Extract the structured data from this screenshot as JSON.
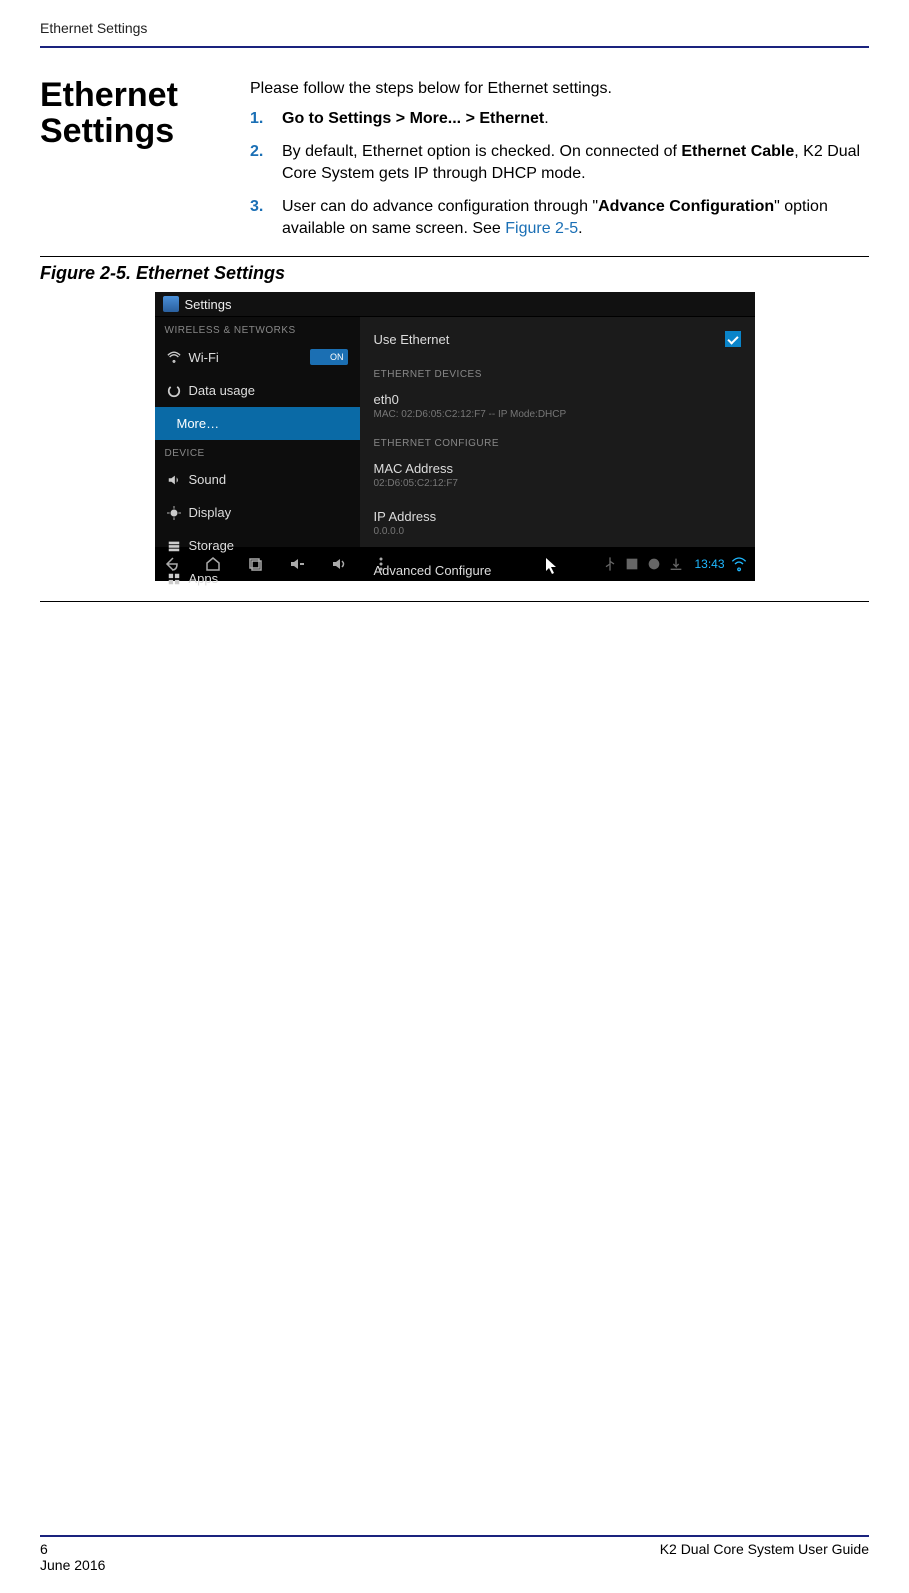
{
  "running_head": "Ethernet Settings",
  "section_heading": "Ethernet Settings",
  "intro": "Please follow the steps below for Ethernet settings.",
  "steps": {
    "s1": {
      "num": "1.",
      "pre": "Go to Settings > More... > Ethernet",
      "post": "."
    },
    "s2": {
      "num": "2.",
      "a": "By default, Ethernet option is checked. On connected of ",
      "b": "Ethernet Cable",
      "c": ", K2 Dual Core System gets IP through DHCP mode."
    },
    "s3": {
      "num": "3.",
      "a": "User can do advance configuration through \"",
      "b": "Advance Configuration",
      "c": "\" option available on same screen. See ",
      "xref": "Figure 2-5",
      "d": "."
    }
  },
  "figure_caption": "Figure 2-5. Ethernet Settings",
  "shot": {
    "title": "Settings",
    "cat1": "WIRELESS & NETWORKS",
    "wifi": "Wi-Fi",
    "wifi_toggle": "ON",
    "data_usage": "Data usage",
    "more": "More…",
    "cat2": "DEVICE",
    "sound": "Sound",
    "display": "Display",
    "storage": "Storage",
    "apps": "Apps",
    "use_eth": "Use Ethernet",
    "eth_devices": "ETHERNET DEVICES",
    "eth0": "eth0",
    "eth0_sub": "MAC: 02:D6:05:C2:12:F7 -- IP Mode:DHCP",
    "eth_conf": "ETHERNET CONFIGURE",
    "mac_addr": "MAC Address",
    "mac_val": "02:D6:05:C2:12:F7",
    "ip_addr": "IP Address",
    "ip_val": "0.0.0.0",
    "adv": "Advanced Configure",
    "clock": "13:43"
  },
  "footer": {
    "page_num": "6",
    "date": "June 2016",
    "doc_title": "K2 Dual Core System User Guide"
  }
}
